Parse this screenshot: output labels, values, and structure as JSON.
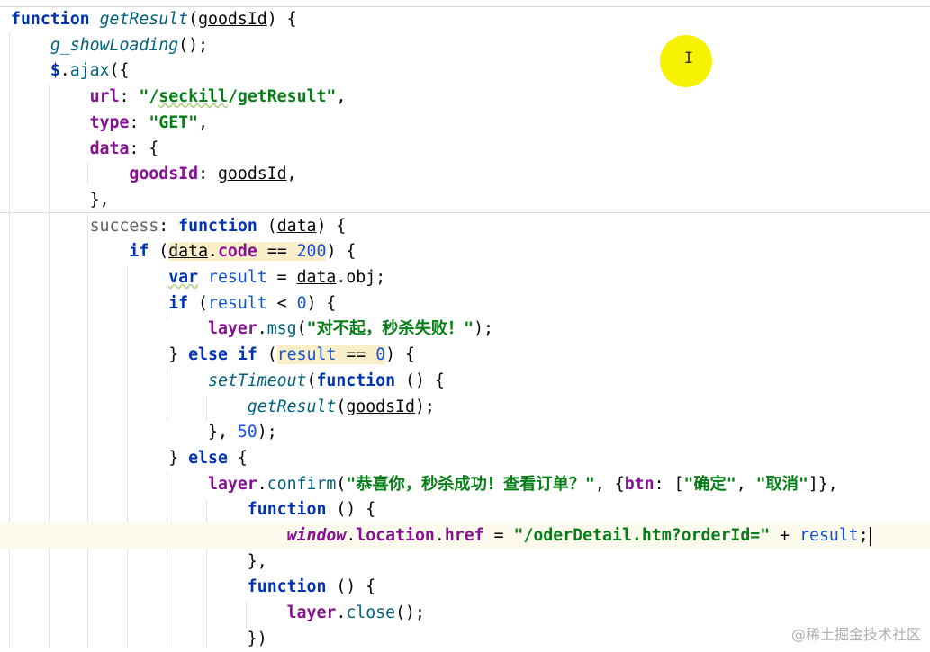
{
  "editor": {
    "lines": [
      [
        {
          "t": "function",
          "c": "kw"
        },
        {
          "t": " "
        },
        {
          "t": "getResult",
          "c": "fn"
        },
        {
          "t": "("
        },
        {
          "t": "goodsId",
          "c": "prm"
        },
        {
          "t": ") {"
        }
      ],
      [
        {
          "t": "    "
        },
        {
          "t": "g_showLoading",
          "c": "fn"
        },
        {
          "t": "();"
        }
      ],
      [
        {
          "t": "    "
        },
        {
          "t": "$",
          "c": "kw"
        },
        {
          "t": "."
        },
        {
          "t": "ajax",
          "c": "mth"
        },
        {
          "t": "({"
        }
      ],
      [
        {
          "t": "        "
        },
        {
          "t": "url",
          "c": "pr"
        },
        {
          "t": ": "
        },
        {
          "t": "\"/",
          "c": "str"
        },
        {
          "t": "seckill",
          "c": "str sq"
        },
        {
          "t": "/getResult\"",
          "c": "str"
        },
        {
          "t": ","
        }
      ],
      [
        {
          "t": "        "
        },
        {
          "t": "type",
          "c": "pr"
        },
        {
          "t": ": "
        },
        {
          "t": "\"GET\"",
          "c": "str"
        },
        {
          "t": ","
        }
      ],
      [
        {
          "t": "        "
        },
        {
          "t": "data",
          "c": "pr"
        },
        {
          "t": ": {"
        }
      ],
      [
        {
          "t": "            "
        },
        {
          "t": "goodsId",
          "c": "pr"
        },
        {
          "t": ": "
        },
        {
          "t": "goodsId",
          "c": "prm"
        },
        {
          "t": ","
        }
      ],
      [
        {
          "t": "        },"
        }
      ],
      [
        {
          "t": "        "
        },
        {
          "t": "success",
          "c": "dim"
        },
        {
          "t": ": "
        },
        {
          "t": "function",
          "c": "kw"
        },
        {
          "t": " ("
        },
        {
          "t": "data",
          "c": "prm"
        },
        {
          "t": ") {"
        }
      ],
      [
        {
          "t": "            "
        },
        {
          "t": "if",
          "c": "kw"
        },
        {
          "t": " ("
        },
        {
          "t": "data",
          "c": "prm hl"
        },
        {
          "t": ".",
          "c": "hl"
        },
        {
          "t": "code",
          "c": "pr hl"
        },
        {
          "t": " == ",
          "c": "hl"
        },
        {
          "t": "200",
          "c": "num hl"
        },
        {
          "t": ") {"
        }
      ],
      [
        {
          "t": "                "
        },
        {
          "t": "var",
          "c": "kw sq"
        },
        {
          "t": " "
        },
        {
          "t": "result",
          "c": "lv"
        },
        {
          "t": " = "
        },
        {
          "t": "data",
          "c": "prm"
        },
        {
          "t": ".obj;"
        }
      ],
      [
        {
          "t": "                "
        },
        {
          "t": "if",
          "c": "kw"
        },
        {
          "t": " ("
        },
        {
          "t": "result",
          "c": "lv"
        },
        {
          "t": " < "
        },
        {
          "t": "0",
          "c": "num"
        },
        {
          "t": ") {"
        }
      ],
      [
        {
          "t": "                    "
        },
        {
          "t": "layer",
          "c": "gl"
        },
        {
          "t": "."
        },
        {
          "t": "msg",
          "c": "mth"
        },
        {
          "t": "("
        },
        {
          "t": "\"对不起，秒杀失败！\"",
          "c": "str"
        },
        {
          "t": ");"
        }
      ],
      [
        {
          "t": "                } "
        },
        {
          "t": "else",
          "c": "kw"
        },
        {
          "t": " "
        },
        {
          "t": "if",
          "c": "kw"
        },
        {
          "t": " ("
        },
        {
          "t": "result",
          "c": "lv hl"
        },
        {
          "t": " == ",
          "c": "hl"
        },
        {
          "t": "0",
          "c": "num hl"
        },
        {
          "t": ") {"
        }
      ],
      [
        {
          "t": "                    "
        },
        {
          "t": "setTimeout",
          "c": "fn"
        },
        {
          "t": "("
        },
        {
          "t": "function",
          "c": "kw"
        },
        {
          "t": " () {"
        }
      ],
      [
        {
          "t": "                        "
        },
        {
          "t": "getResult",
          "c": "fn"
        },
        {
          "t": "("
        },
        {
          "t": "goodsId",
          "c": "prm"
        },
        {
          "t": ");"
        }
      ],
      [
        {
          "t": "                    }, "
        },
        {
          "t": "50",
          "c": "num"
        },
        {
          "t": ");"
        }
      ],
      [
        {
          "t": "                } "
        },
        {
          "t": "else",
          "c": "kw"
        },
        {
          "t": " {"
        }
      ],
      [
        {
          "t": "                    "
        },
        {
          "t": "layer",
          "c": "gl"
        },
        {
          "t": "."
        },
        {
          "t": "confirm",
          "c": "mth"
        },
        {
          "t": "("
        },
        {
          "t": "\"恭喜你，秒杀成功！查看订单？\"",
          "c": "str"
        },
        {
          "t": ", {"
        },
        {
          "t": "btn",
          "c": "pr"
        },
        {
          "t": ": ["
        },
        {
          "t": "\"确定\"",
          "c": "str"
        },
        {
          "t": ", "
        },
        {
          "t": "\"取消\"",
          "c": "str"
        },
        {
          "t": "]},"
        }
      ],
      [
        {
          "t": "                        "
        },
        {
          "t": "function",
          "c": "kw"
        },
        {
          "t": " () {"
        }
      ],
      [
        {
          "t": "                            "
        },
        {
          "t": "window",
          "c": "glob"
        },
        {
          "t": "."
        },
        {
          "t": "location",
          "c": "pr"
        },
        {
          "t": "."
        },
        {
          "t": "href",
          "c": "pr"
        },
        {
          "t": " = "
        },
        {
          "t": "\"/oderDetail.htm?orderId=\"",
          "c": "str"
        },
        {
          "t": " + "
        },
        {
          "t": "result",
          "c": "lv"
        },
        {
          "t": ";"
        }
      ],
      [
        {
          "t": "                        },"
        }
      ],
      [
        {
          "t": "                        "
        },
        {
          "t": "function",
          "c": "kw"
        },
        {
          "t": " () {"
        }
      ],
      [
        {
          "t": "                            "
        },
        {
          "t": "layer",
          "c": "gl"
        },
        {
          "t": "."
        },
        {
          "t": "close",
          "c": "mth"
        },
        {
          "t": "();"
        }
      ],
      [
        {
          "t": "                        })"
        }
      ]
    ],
    "current_line": 20
  },
  "watermark": "@稀土掘金技术社区"
}
